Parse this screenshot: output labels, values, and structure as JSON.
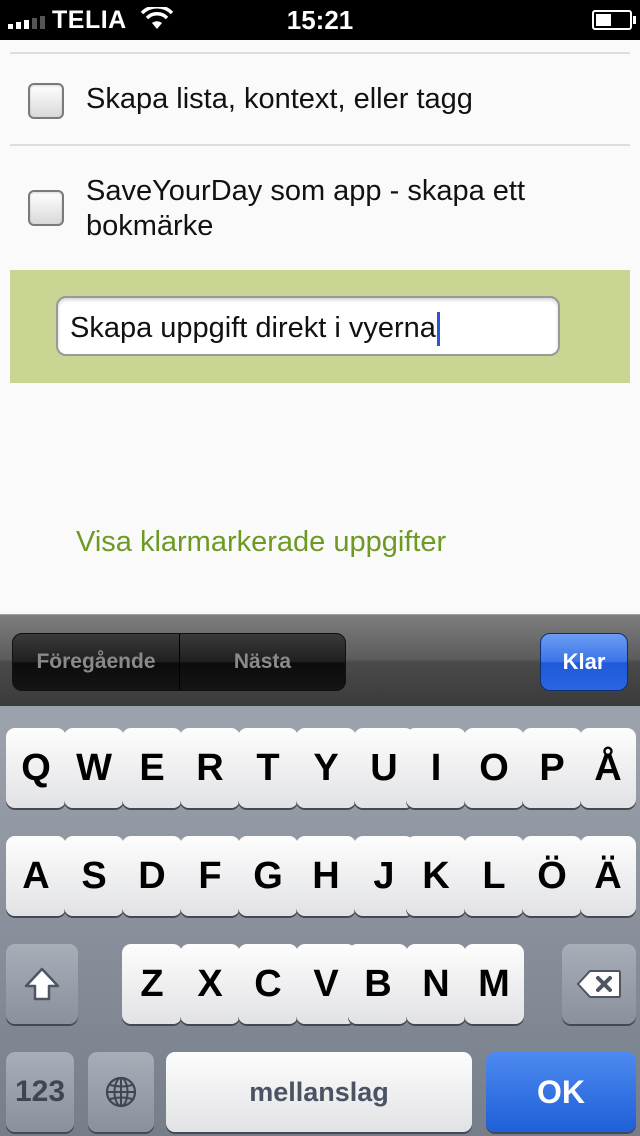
{
  "status_bar": {
    "carrier": "TELIA",
    "time": "15:21"
  },
  "tasks": [
    {
      "label": "Skapa lista, kontext, eller tagg",
      "checked": false
    },
    {
      "label": "SaveYourDay som app - skapa ett bokmärke",
      "checked": false
    }
  ],
  "new_task_input": {
    "value": "Skapa uppgift direkt i vyerna"
  },
  "show_completed_link": "Visa klarmarkerade uppgifter",
  "form_assistant": {
    "previous_label": "Föregående",
    "next_label": "Nästa",
    "done_label": "Klar"
  },
  "keyboard": {
    "row1": [
      "Q",
      "W",
      "E",
      "R",
      "T",
      "Y",
      "U",
      "I",
      "O",
      "P",
      "Å"
    ],
    "row2": [
      "A",
      "S",
      "D",
      "F",
      "G",
      "H",
      "J",
      "K",
      "L",
      "Ö",
      "Ä"
    ],
    "row3": [
      "Z",
      "X",
      "C",
      "V",
      "B",
      "N",
      "M"
    ],
    "numbers_label": "123",
    "space_label": "mellanslag",
    "return_label": "OK"
  },
  "colors": {
    "panel": "#c9d693",
    "link": "#6e9a24",
    "accent": "#2a66e0"
  }
}
